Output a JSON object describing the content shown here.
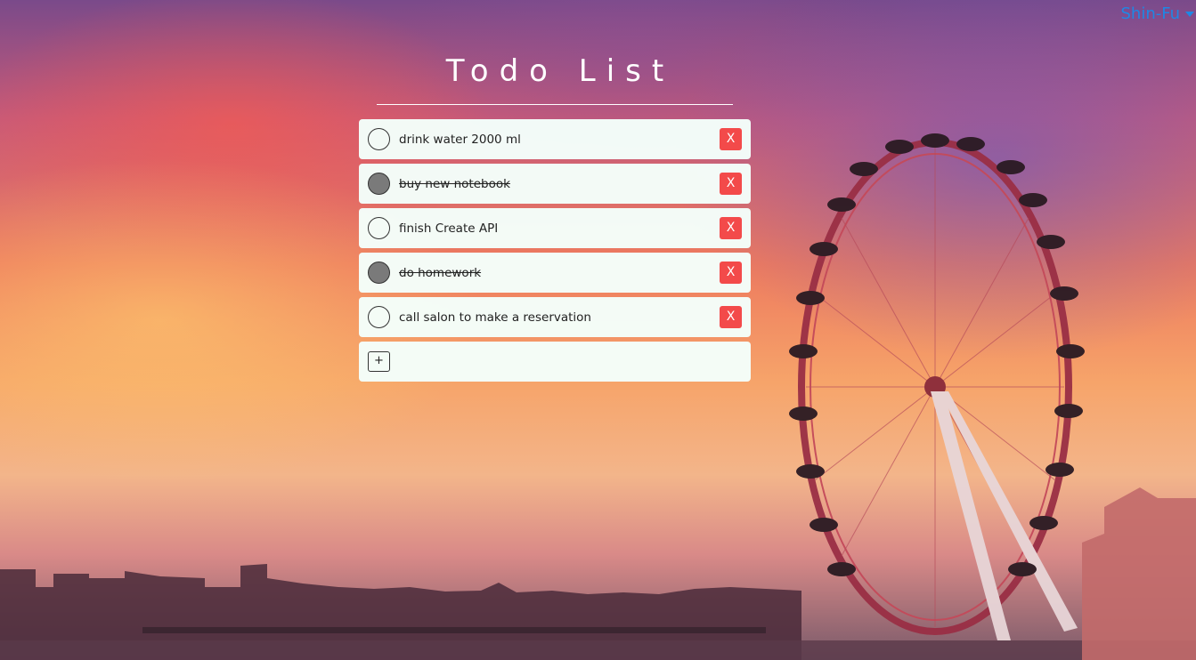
{
  "user": {
    "name": "Shin-Fu"
  },
  "app": {
    "title": "Todo List"
  },
  "todos": [
    {
      "text": "drink water 2000 ml",
      "done": false
    },
    {
      "text": "buy new notebook",
      "done": true
    },
    {
      "text": "finish Create API",
      "done": false
    },
    {
      "text": "do homework",
      "done": true
    },
    {
      "text": "call salon to make a reservation",
      "done": false
    }
  ],
  "labels": {
    "delete": "X",
    "add": "+"
  },
  "colors": {
    "accent": "#1e88e5",
    "delete": "#f34a4a",
    "card": "#f4fffb",
    "done_check": "#7a7a7a"
  },
  "background": {
    "scene": "london-eye-sunset"
  }
}
